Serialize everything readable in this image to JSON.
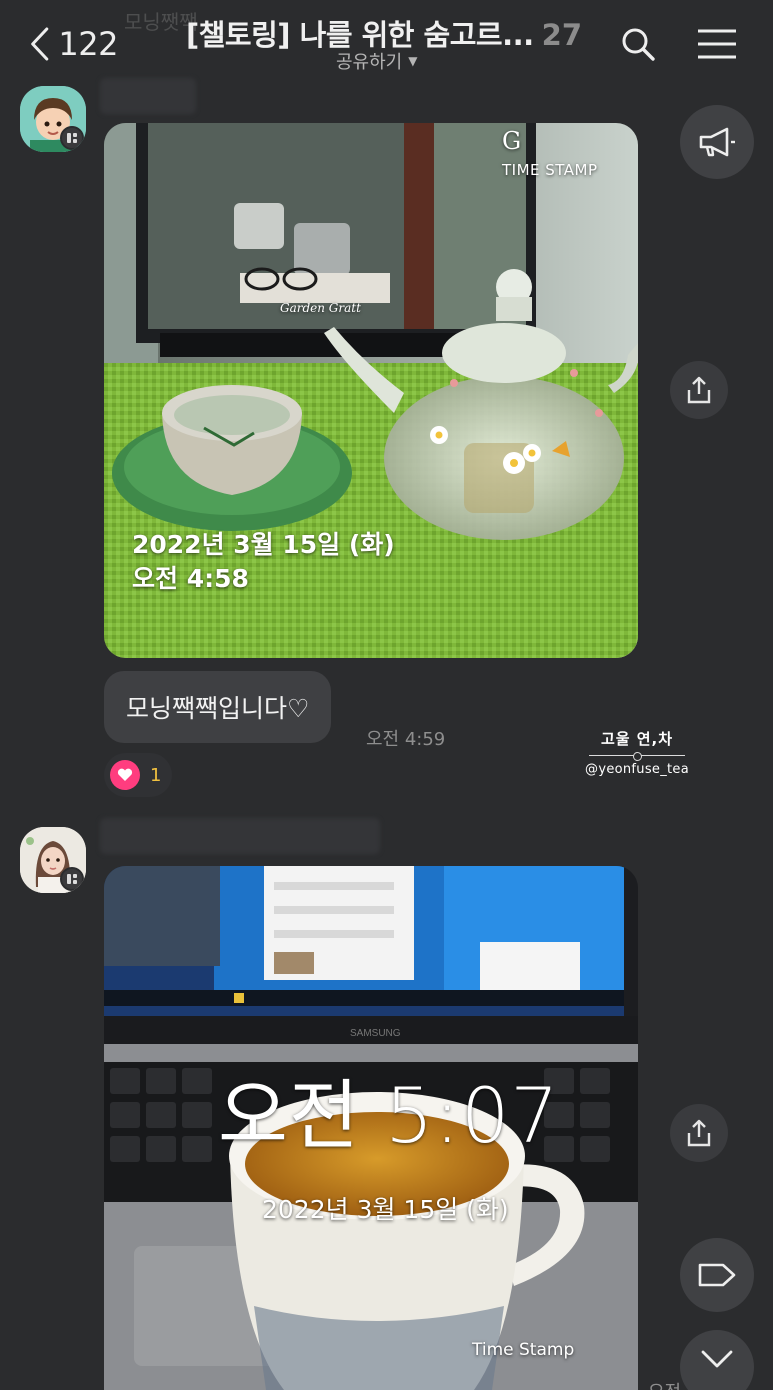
{
  "header": {
    "ghost_text": "모닝쨋짹",
    "back_count": "122",
    "title": "[챌토링] 나를 위한 숨고르...",
    "member_count": "27",
    "subtitle": "공유하기"
  },
  "messages": [
    {
      "photo": {
        "date_text": "2022년 3월 15일 (화)",
        "time_text": "오전 4:58",
        "stamp_g": "G",
        "stamp_label": "TIME STAMP",
        "script_text": "Garden Gratt"
      },
      "bubble_text": "모닝짹짹입니다♡",
      "time": "오전 4:59",
      "reaction_count": "1"
    },
    {
      "photo": {
        "time_text": "오전 5:07",
        "date_text": "2022년 3월 15일 (화)",
        "stamp_label": "Time Stamp",
        "laptop_brand": "SAMSUNG"
      },
      "time_partial": "오전"
    }
  ],
  "watermark": {
    "title": "고울 연,차",
    "handle": "@yeonfuse_tea"
  },
  "icons": [
    "back-icon",
    "search-icon",
    "menu-icon",
    "megaphone-icon",
    "share-icon",
    "tag-icon",
    "chevron-down-icon",
    "heart-icon"
  ]
}
